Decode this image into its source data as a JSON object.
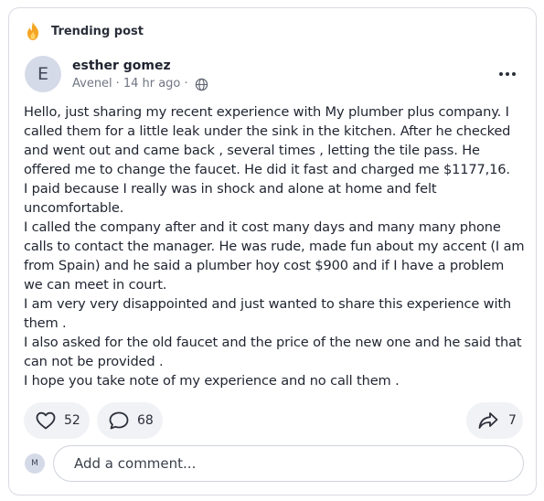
{
  "header": {
    "trending_label": "Trending post",
    "flame_icon": "flame-icon",
    "accent_color": "#F5A524"
  },
  "author": {
    "initial": "E",
    "name": "esther gomez",
    "location": "Avenel",
    "separator": "·",
    "time": "14 hr ago ·",
    "visibility_icon": "globe-icon",
    "avatar_color": "#D5DAE8"
  },
  "post": {
    "paragraphs": [
      "Hello, just sharing my recent experience with My plumber plus company. I called them for a little leak under the sink in the kitchen. After he checked and went out and came back , several times , letting the tile pass. He offered me to change the faucet. He did it fast and charged me $1177,16.",
      "I paid because I really was in shock and alone at home and felt uncomfortable.",
      "I called the company after and it cost many days and many many phone calls to contact the manager. He was rude, made fun about my accent (I am from Spain)  and he said a plumber hoy cost $900 and if I have a problem we can meet in court.",
      "I am very very disappointed and just wanted to share this experience with them .",
      "I also asked for the old faucet and the price of the new one and he said that can not be provided .",
      "I hope you take note of my experience and no call them ."
    ]
  },
  "actions": {
    "like_icon": "heart-icon",
    "like_count": "52",
    "comment_icon": "comment-bubble-icon",
    "comment_count": "68",
    "share_icon": "share-arrow-icon",
    "share_count": "7"
  },
  "comment_box": {
    "user_initial": "M",
    "placeholder": "Add a comment..."
  }
}
